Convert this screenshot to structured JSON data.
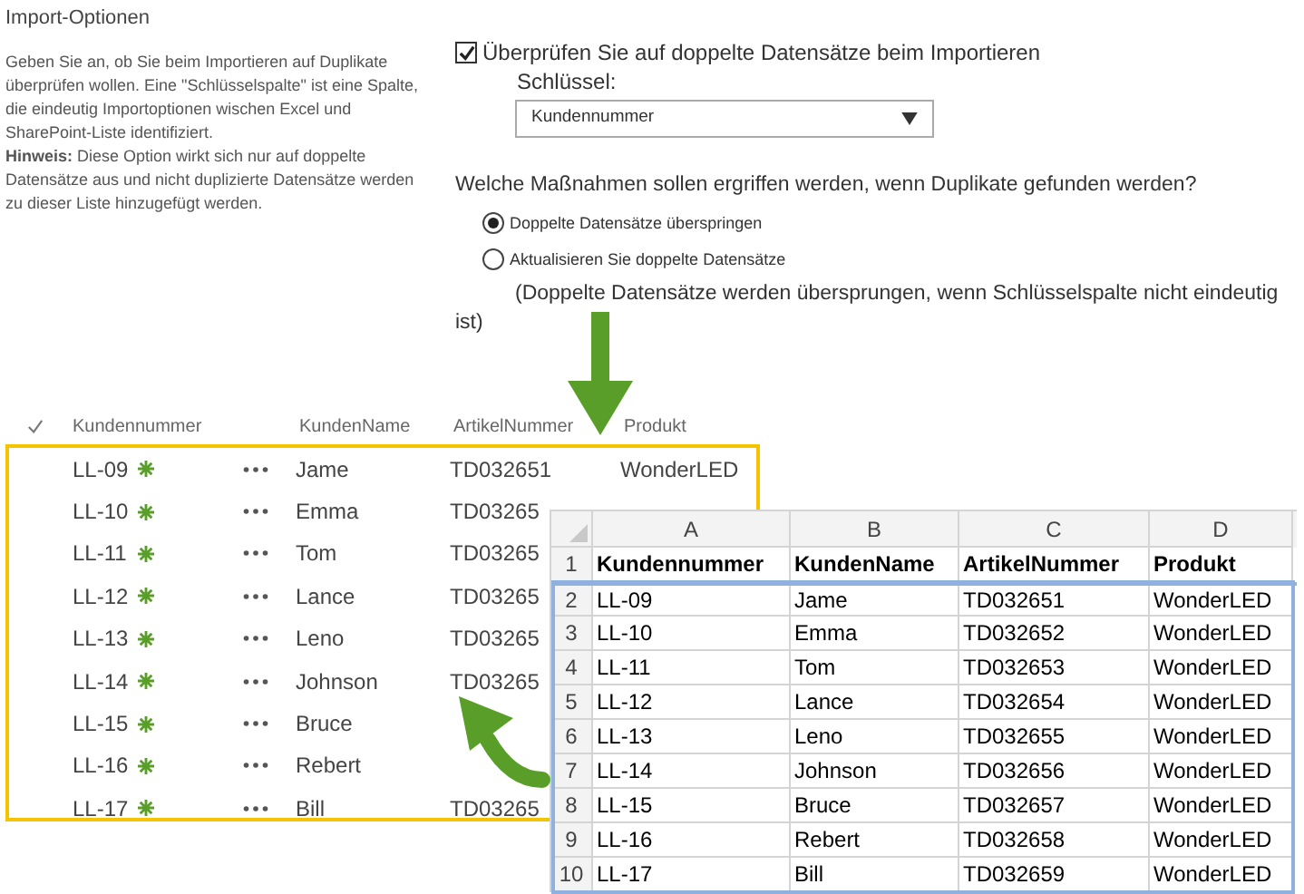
{
  "section": {
    "title": "Import-Optionen",
    "description": "Geben Sie an, ob Sie beim Importieren auf Duplikate überprüfen wollen. Eine \"Schlüsselspalte\" ist eine Spalte, die eindeutig Importoptionen wischen Excel und SharePoint-Liste identifiziert.",
    "hint": "**Hinweis:** Diese Option wirkt sich nur auf doppelte Datensätze aus und nicht duplizierte Datensätze werden zu dieser Liste hinzugefügt werden."
  },
  "options": {
    "check": {
      "label": "Überprüfen Sie auf doppelte Datensätze beim Importieren",
      "checked": true
    },
    "key_label": "Schlüssel:",
    "key_select": {
      "value": "Kundennummer"
    },
    "question": "Welche Maßnahmen sollen ergriffen werden, wenn Duplikate gefunden werden?",
    "radios": [
      {
        "label": "Doppelte Datensätze überspringen",
        "selected": true
      },
      {
        "label": "Aktualisieren Sie doppelte Datensätze",
        "selected": false
      }
    ],
    "note": "(Doppelte Datensätze werden übersprungen, wenn Schlüsselspalte nicht eindeutig ist)"
  },
  "list": {
    "columns": [
      "Kundennummer",
      "KundenName",
      "ArtikelNummer",
      "Produkt"
    ],
    "rows": [
      {
        "id": "LL-09",
        "name": "Jame",
        "article": "TD032651",
        "product": "WonderLED"
      },
      {
        "id": "LL-10",
        "name": "Emma",
        "article": "TD03265"
      },
      {
        "id": "LL-11",
        "name": "Tom",
        "article": "TD03265"
      },
      {
        "id": "LL-12",
        "name": "Lance",
        "article": "TD03265"
      },
      {
        "id": "LL-13",
        "name": "Leno",
        "article": "TD03265"
      },
      {
        "id": "LL-14",
        "name": "Johnson",
        "article": "TD03265"
      },
      {
        "id": "LL-15",
        "name": "Bruce"
      },
      {
        "id": "LL-16",
        "name": "Rebert"
      },
      {
        "id": "LL-17",
        "name": "Bill",
        "article": "TD03265"
      }
    ]
  },
  "sheet": {
    "columns": [
      "A",
      "B",
      "C",
      "D"
    ],
    "header": {
      "num": "1",
      "cells": [
        "Kundennummer",
        "KundenName",
        "ArtikelNummer",
        "Produkt"
      ]
    },
    "rows": [
      {
        "num": "2",
        "cells": [
          "LL-09",
          "Jame",
          "TD032651",
          "WonderLED"
        ]
      },
      {
        "num": "3",
        "cells": [
          "LL-10",
          "Emma",
          "TD032652",
          "WonderLED"
        ]
      },
      {
        "num": "4",
        "cells": [
          "LL-11",
          "Tom",
          "TD032653",
          "WonderLED"
        ]
      },
      {
        "num": "5",
        "cells": [
          "LL-12",
          "Lance",
          "TD032654",
          "WonderLED"
        ]
      },
      {
        "num": "6",
        "cells": [
          "LL-13",
          "Leno",
          "TD032655",
          "WonderLED"
        ]
      },
      {
        "num": "7",
        "cells": [
          "LL-14",
          "Johnson",
          "TD032656",
          "WonderLED"
        ]
      },
      {
        "num": "8",
        "cells": [
          "LL-15",
          "Bruce",
          "TD032657",
          "WonderLED"
        ]
      },
      {
        "num": "9",
        "cells": [
          "LL-16",
          "Rebert",
          "TD032658",
          "WonderLED"
        ]
      },
      {
        "num": "10",
        "cells": [
          "LL-17",
          "Bill",
          "TD032659",
          "WonderLED"
        ]
      }
    ]
  }
}
